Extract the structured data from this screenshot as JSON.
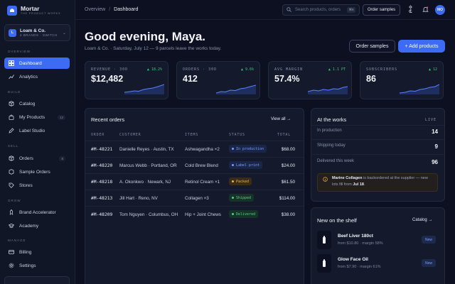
{
  "brand": {
    "name": "Mortar",
    "tagline": "THE PRODUCT WORKS"
  },
  "org": {
    "initial": "L",
    "name": "Loam & Co.",
    "sub": "2 BRANDS · SWITCH"
  },
  "sidebar": {
    "sections": [
      "OVERVIEW",
      "BUILD",
      "SELL",
      "GROW",
      "MANAGE"
    ],
    "items": [
      {
        "label": "Dashboard",
        "icon": "dashboard-icon"
      },
      {
        "label": "Analytics",
        "icon": "chart-icon"
      },
      {
        "label": "Catalog",
        "icon": "box-icon"
      },
      {
        "label": "My Products",
        "icon": "bag-icon",
        "count": "12"
      },
      {
        "label": "Label Studio",
        "icon": "pen-icon"
      },
      {
        "label": "Orders",
        "icon": "package-icon",
        "count": "8"
      },
      {
        "label": "Sample Orders",
        "icon": "cube-icon"
      },
      {
        "label": "Stores",
        "icon": "tag-icon"
      },
      {
        "label": "Brand Accelerator",
        "icon": "rocket-icon"
      },
      {
        "label": "Academy",
        "icon": "graduation-cap-icon"
      },
      {
        "label": "Billing",
        "icon": "card-icon"
      },
      {
        "label": "Settings",
        "icon": "gear-icon"
      }
    ]
  },
  "topbar": {
    "crumb_parent": "Overview",
    "crumb_current": "Dashboard",
    "search_placeholder": "Search products, orders",
    "search_kbd": "⌘K",
    "order_samples": "Order samples",
    "avatar": "MO"
  },
  "hero": {
    "greeting": "Good evening, Maya.",
    "subtitle": "Loam & Co. · Saturday, July 12 — 9 parcels leave the works today.",
    "btn_secondary": "Order samples",
    "btn_primary": "+ Add products"
  },
  "stats": [
    {
      "label": "REVENUE · 30D",
      "value": "$12,482",
      "delta": "▲ 18.2%"
    },
    {
      "label": "ORDERS · 30D",
      "value": "412",
      "delta": "▲ 9.6%"
    },
    {
      "label": "AVG MARGIN",
      "value": "57.4%",
      "delta": "▲ 1.1 PT"
    },
    {
      "label": "SUBSCRIBERS",
      "value": "86",
      "delta": "▲ 12"
    }
  ],
  "orders": {
    "title": "Recent orders",
    "link": "View all →",
    "columns": [
      "ORDER",
      "CUSTOMER",
      "ITEMS",
      "STATUS",
      "TOTAL"
    ],
    "rows": [
      {
        "id": "#M-48221",
        "customer": "Danielle Reyes · Austin, TX",
        "items": "Ashwagandha ×2",
        "status": "In production",
        "total": "$68.00"
      },
      {
        "id": "#M-48220",
        "customer": "Marcus Webb · Portland, OR",
        "items": "Cold Brew Blend",
        "status": "Label print",
        "total": "$24.00"
      },
      {
        "id": "#M-48218",
        "customer": "A. Okonkwo · Newark, NJ",
        "items": "Retinol Cream ×1",
        "status": "Packed",
        "total": "$61.50"
      },
      {
        "id": "#M-48213",
        "customer": "Jill Hart · Reno, NV",
        "items": "Collagen ×3",
        "status": "Shipped",
        "total": "$114.00"
      },
      {
        "id": "#M-48209",
        "customer": "Tom Nguyen · Columbus, OH",
        "items": "Hip + Joint Chews",
        "status": "Delivered",
        "total": "$38.00"
      }
    ]
  },
  "works": {
    "title": "At the works",
    "live": "LIVE",
    "rows": [
      {
        "label": "In production",
        "value": "14"
      },
      {
        "label": "Shipping today",
        "value": "9"
      },
      {
        "label": "Delivered this week",
        "value": "96"
      }
    ],
    "alert_name": "Marine Collagen",
    "alert_text": " is backordered at the supplier — new lots fill from ",
    "alert_date": "Jul 18",
    "alert_end": "."
  },
  "shelf": {
    "title": "New on the shelf",
    "link": "Catalog →",
    "items": [
      {
        "name": "Beef Liver 180ct",
        "meta": "from $10.80 · margin 58%",
        "badge": "New"
      },
      {
        "name": "Glow Face Oil",
        "meta": "from $7.90 · margin 61%",
        "badge": "New"
      }
    ]
  },
  "colors": {
    "accent": "#3d6bf5",
    "positive": "#38c97a",
    "warning": "#e0a23a"
  }
}
